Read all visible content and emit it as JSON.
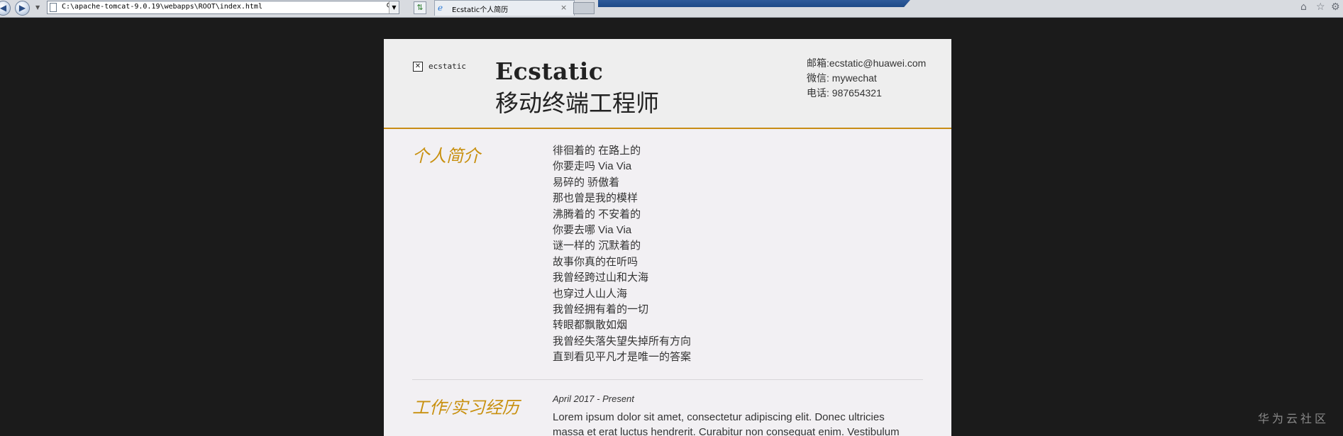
{
  "browser": {
    "url": "C:\\apache-tomcat-9.0.19\\webapps\\ROOT\\index.html",
    "tab_title": "Ecstatic个人简历",
    "back_icon": "back-arrow-icon",
    "forward_icon": "forward-arrow-icon",
    "tab_close": "×"
  },
  "header": {
    "logo_text": "ecstatic",
    "name": "Ecstatic",
    "role": "移动终端工程师",
    "contact": {
      "email": "邮箱:ecstatic@huawei.com",
      "wechat": "微信: mywechat",
      "phone": "电话: 987654321"
    }
  },
  "sections": {
    "profile": {
      "title": "个人简介",
      "lines": [
        "徘徊着的 在路上的",
        "你要走吗 Via Via",
        "易碎的 骄傲着",
        "那也曾是我的模样",
        "沸腾着的 不安着的",
        "你要去哪 Via Via",
        "谜一样的 沉默着的",
        "故事你真的在听吗",
        "我曾经跨过山和大海",
        "也穿过人山人海",
        "我曾经拥有着的一切",
        "转眼都飘散如烟",
        "我曾经失落失望失掉所有方向",
        "直到看见平凡才是唯一的答案"
      ]
    },
    "experience": {
      "title": "工作/实习经历",
      "date": "April 2017 - Present",
      "line1": "Lorem ipsum dolor sit amet, consectetur adipiscing elit. Donec ultricies",
      "line2": "massa et erat luctus hendrerit. Curabitur non consequat enim. Vestibulum"
    }
  },
  "watermark": "华为云社区",
  "colors": {
    "accent": "#c8900f",
    "background": "#1b1b1b",
    "page": "#f2f0f3",
    "header": "#eeeeee"
  }
}
